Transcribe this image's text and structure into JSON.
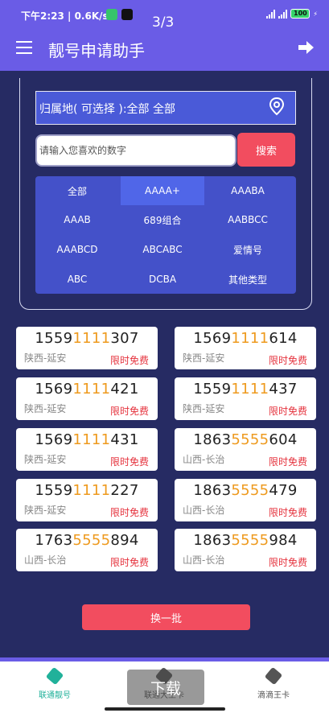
{
  "status_bar": {
    "time": "下午2:23 | 0.6K/s",
    "page_indicator": "3/3",
    "battery": "100"
  },
  "appbar": {
    "title": "靓号申请助手"
  },
  "filter": {
    "region_label": "归属地( 可选择 ):全部 全部",
    "search_placeholder": "请输入您喜欢的数字",
    "search_label": "搜索",
    "types": [
      "全部",
      "AAAA+",
      "AAABA",
      "AAAB",
      "689组合",
      "AABBCC",
      "AAABCD",
      "ABCABC",
      "爱情号",
      "ABC",
      "DCBA",
      "其他类型"
    ],
    "selected_type": "AAAA+"
  },
  "numbers": [
    {
      "prefix": "1559",
      "highlight": "1111",
      "suffix": "307",
      "location": "陕西-延安",
      "tag": "限时免费"
    },
    {
      "prefix": "1569",
      "highlight": "1111",
      "suffix": "614",
      "location": "陕西-延安",
      "tag": "限时免费"
    },
    {
      "prefix": "1569",
      "highlight": "1111",
      "suffix": "421",
      "location": "陕西-延安",
      "tag": "限时免费"
    },
    {
      "prefix": "1559",
      "highlight": "1111",
      "suffix": "437",
      "location": "陕西-延安",
      "tag": "限时免费"
    },
    {
      "prefix": "1569",
      "highlight": "1111",
      "suffix": "431",
      "location": "陕西-延安",
      "tag": "限时免费"
    },
    {
      "prefix": "1863",
      "highlight": "5555",
      "suffix": "604",
      "location": "山西-长治",
      "tag": "限时免费"
    },
    {
      "prefix": "1559",
      "highlight": "1111",
      "suffix": "227",
      "location": "陕西-延安",
      "tag": "限时免费"
    },
    {
      "prefix": "1863",
      "highlight": "5555",
      "suffix": "479",
      "location": "山西-长治",
      "tag": "限时免费"
    },
    {
      "prefix": "1763",
      "highlight": "5555",
      "suffix": "894",
      "location": "山西-长治",
      "tag": "限时免费"
    },
    {
      "prefix": "1863",
      "highlight": "5555",
      "suffix": "984",
      "location": "山西-长治",
      "tag": "限时免费"
    }
  ],
  "refresh_label": "换一批",
  "bottom_nav": [
    {
      "label": "联通靓号",
      "icon": "sim-card-icon",
      "color": "#21b19a",
      "active": true
    },
    {
      "label": "联通大王卡",
      "icon": "sim-card-icon",
      "color": "#555555",
      "active": false
    },
    {
      "label": "滴滴王卡",
      "icon": "sim-card-icon",
      "color": "#555555",
      "active": false
    }
  ],
  "overlay": {
    "download_label": "下载"
  },
  "colors": {
    "primary": "#6a5ce6",
    "background": "#262b63",
    "accent_red": "#f24d5f",
    "digit_highlight": "#ee9a1e"
  }
}
